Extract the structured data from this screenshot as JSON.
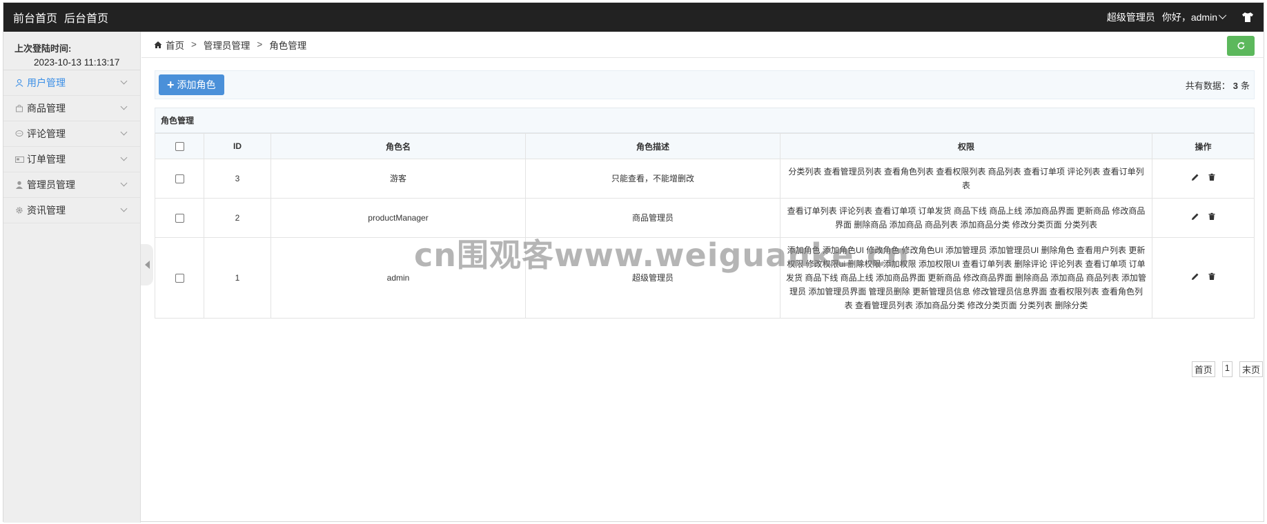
{
  "topbar": {
    "links": [
      "前台首页",
      "后台首页"
    ],
    "role": "超级管理员",
    "greeting": "你好，admin"
  },
  "sidebar": {
    "last_login_label": "上次登陆时间:",
    "last_login_value": "2023-10-13 11:13:17",
    "items": [
      {
        "label": "用户管理",
        "icon": "user-icon",
        "active": true
      },
      {
        "label": "商品管理",
        "icon": "bag-icon",
        "active": false
      },
      {
        "label": "评论管理",
        "icon": "comment-icon",
        "active": false
      },
      {
        "label": "订单管理",
        "icon": "card-icon",
        "active": false
      },
      {
        "label": "管理员管理",
        "icon": "admin-icon",
        "active": false
      },
      {
        "label": "资讯管理",
        "icon": "gear-icon",
        "active": false
      }
    ]
  },
  "breadcrumb": {
    "home": "首页",
    "sep": ">",
    "level1": "管理员管理",
    "level2": "角色管理"
  },
  "toolbar": {
    "add_label": "添加角色",
    "total_prefix": "共有数据：",
    "total_count": "3",
    "total_suffix": "条"
  },
  "table": {
    "caption": "角色管理",
    "headers": [
      "ID",
      "角色名",
      "角色描述",
      "权限",
      "操作"
    ],
    "rows": [
      {
        "id": "3",
        "name": "游客",
        "desc": "只能查看，不能增删改",
        "perms": "分类列表 查看管理员列表 查看角色列表 查看权限列表 商品列表 查看订单项 评论列表 查看订单列表"
      },
      {
        "id": "2",
        "name": "productManager",
        "desc": "商品管理员",
        "perms": "查看订单列表 评论列表 查看订单项 订单发货 商品下线 商品上线 添加商品界面 更新商品 修改商品界面 删除商品 添加商品 商品列表 添加商品分类 修改分类页面 分类列表"
      },
      {
        "id": "1",
        "name": "admin",
        "desc": "超级管理员",
        "perms": "添加角色 添加角色UI 修改角色 修改角色UI 添加管理员 添加管理员UI 删除角色 查看用户列表 更新权限 修改权限ui 删除权限 添加权限 添加权限UI 查看订单列表 删除评论 评论列表 查看订单项 订单发货 商品下线 商品上线 添加商品界面 更新商品 修改商品界面 删除商品 添加商品 商品列表 添加管理员 添加管理员界面 管理员删除 更新管理员信息 修改管理员信息界面 查看权限列表 查看角色列表 查看管理员列表 添加商品分类 修改分类页面 分类列表 删除分类"
      }
    ]
  },
  "pager": {
    "first": "首页",
    "page": "1",
    "last": "末页"
  },
  "watermark": "cn围观客www.weiguanke.cn",
  "colors": {
    "topbar": "#222222",
    "accent": "#4a90d9",
    "refresh": "#5cb85c",
    "sidebar": "#eeeeee"
  }
}
